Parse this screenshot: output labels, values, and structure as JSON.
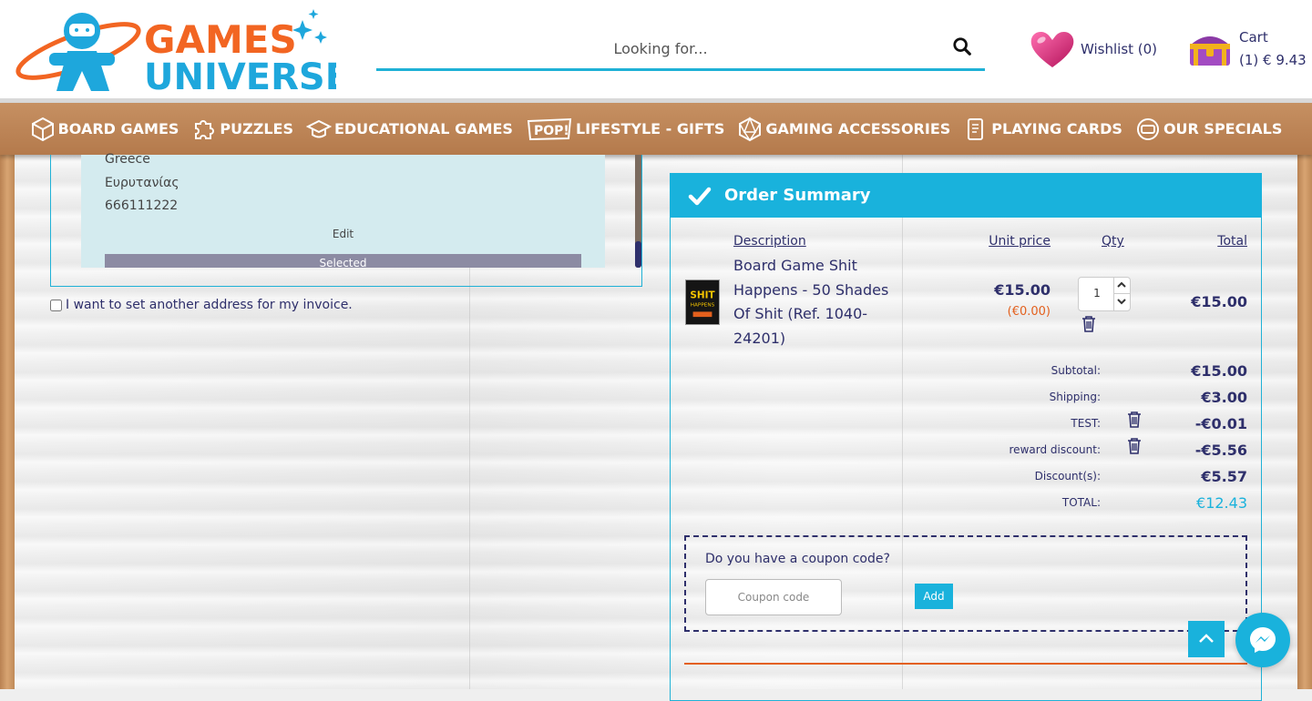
{
  "header": {
    "logo_text": "GAMES UNIVERSE",
    "search": {
      "placeholder": "Looking for..."
    },
    "wishlist": {
      "label": "Wishlist (0)"
    },
    "cart": {
      "label": "Cart",
      "summary": "(1) € 9.43"
    }
  },
  "nav": {
    "items": [
      {
        "label": "BOARD GAMES",
        "icon": "dice-icon"
      },
      {
        "label": "PUZZLES",
        "icon": "puzzle-icon"
      },
      {
        "label": "EDUCATIONAL GAMES",
        "icon": "graduation-cap-icon"
      },
      {
        "label": "LIFESTYLE - GIFTS",
        "icon": "pop-icon"
      },
      {
        "label": "GAMING ACCESSORIES",
        "icon": "d20-icon"
      },
      {
        "label": "PLAYING CARDS",
        "icon": "cards-icon"
      },
      {
        "label": "OUR SPECIALS",
        "icon": "specials-icon"
      }
    ]
  },
  "address": {
    "lines": [
      "Greece",
      "Ευρυτανίας",
      "666111222"
    ],
    "edit_label": "Edit",
    "selected_label": "Selected"
  },
  "invoice": {
    "label": "I want to set another address for my invoice."
  },
  "summary": {
    "title": "Order Summary",
    "columns": {
      "description": "Description",
      "unit_price": "Unit price",
      "qty": "Qty",
      "total": "Total"
    },
    "product": {
      "name": "Board Game Shit Happens - 50 Shades Of Shit (Ref. 1040-24201)",
      "unit_price": "€15.00",
      "unit_price_sub": "(€0.00)",
      "qty": "1",
      "total": "€15.00"
    },
    "totals": [
      {
        "label": "Subtotal:",
        "value": "€15.00"
      },
      {
        "label": "Shipping:",
        "value": "€3.00"
      },
      {
        "label": "TEST:",
        "value": "-€0.01"
      },
      {
        "label": "reward discount:",
        "value": "-€5.56"
      },
      {
        "label": "Discount(s):",
        "value": "€5.57"
      },
      {
        "label": "TOTAL:",
        "value": "€12.43"
      }
    ],
    "coupon": {
      "question": "Do you have a coupon code?",
      "placeholder": "Coupon code",
      "add_label": "Add"
    }
  },
  "colors": {
    "accent": "#19b2dc",
    "navy": "#2e2f6b",
    "orange": "#e3601d",
    "nav_bg": "#bd8556"
  }
}
